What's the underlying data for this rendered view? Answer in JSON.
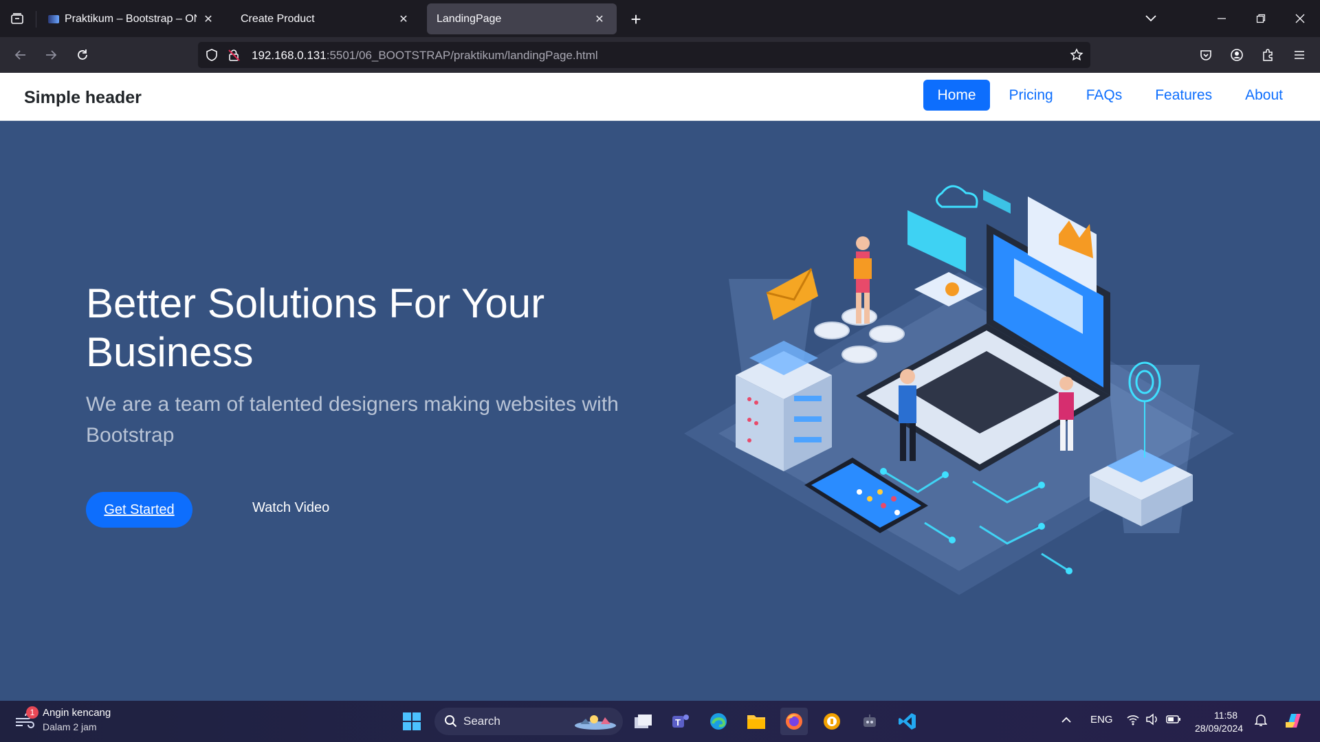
{
  "browser": {
    "tabs": [
      {
        "title": "Praktikum – Bootstrap – ONE by",
        "active": false
      },
      {
        "title": "Create Product",
        "active": false
      },
      {
        "title": "LandingPage",
        "active": true
      }
    ],
    "url_host": "192.168.0.131",
    "url_path": ":5501/06_BOOTSTRAP/praktikum/landingPage.html"
  },
  "site": {
    "brand": "Simple header",
    "nav": [
      "Home",
      "Pricing",
      "FAQs",
      "Features",
      "About"
    ],
    "active_nav": "Home",
    "accent_color": "#0d6efd",
    "hero_bg": "#365280"
  },
  "hero": {
    "title": "Better Solutions For Your Business",
    "subtitle": "We are a team of talented designers making websites with Bootstrap",
    "primary_button": "Get Started",
    "secondary_button": "Watch Video"
  },
  "taskbar": {
    "weather_title": "Angin kencang",
    "weather_sub": "Dalam 2 jam",
    "weather_badge": "1",
    "search_label": "Search",
    "language": "ENG",
    "time": "11:58",
    "date": "28/09/2024"
  }
}
